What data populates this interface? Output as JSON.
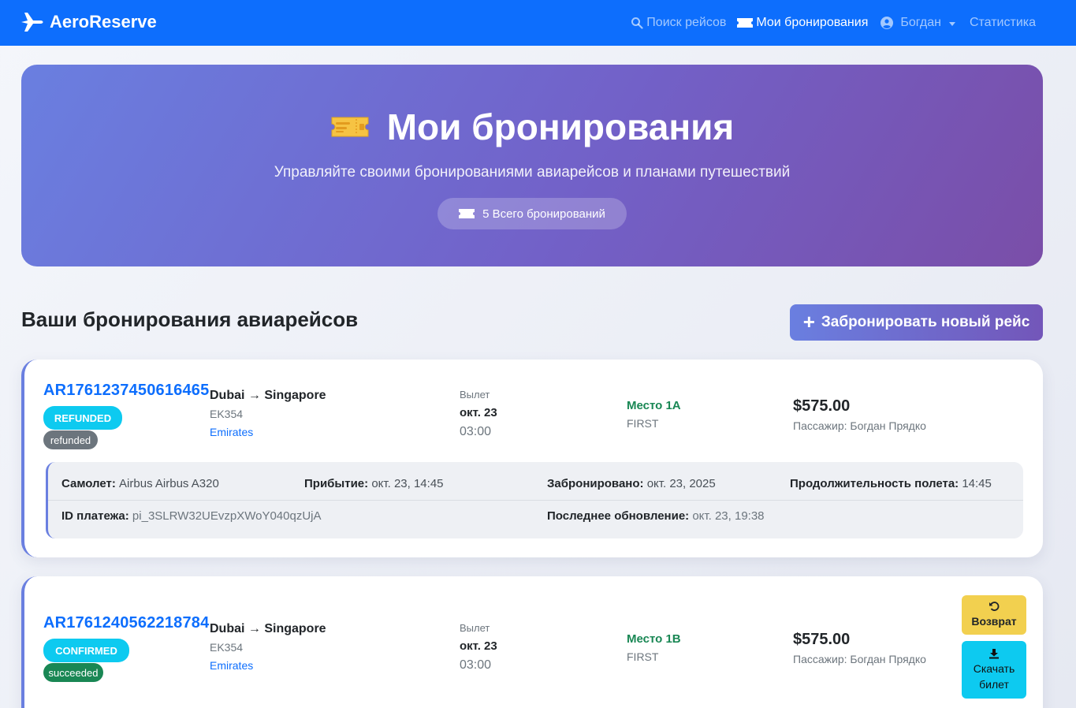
{
  "navbar": {
    "brand": "AeroReserve",
    "items": [
      {
        "label": "Поиск рейсов",
        "icon": "search-icon"
      },
      {
        "label": "Мои бронирования",
        "icon": "ticket-icon"
      },
      {
        "label": "Богдан",
        "icon": "user-circle-icon"
      },
      {
        "label": "Статистика"
      }
    ]
  },
  "hero": {
    "title": "Мои бронирования",
    "subtitle": "Управляйте своими бронированиями авиарейсов и планами путешествий",
    "total_label": "5 Всего бронирований"
  },
  "section": {
    "title": "Ваши бронирования авиарейсов",
    "new_booking_button": "Забронировать новый рейс"
  },
  "bookings": [
    {
      "reference": "AR1761237450616465",
      "status": "REFUNDED",
      "payment_status": "refunded",
      "route": "Dubai → Singapore",
      "flight_number": "EK354",
      "airline": "Emirates",
      "departure_label": "Вылет",
      "departure_date": "окт. 23",
      "departure_time": "03:00",
      "seat": "Место 1A",
      "class": "FIRST",
      "price": "$575.00",
      "passenger": "Пассажир: Богдан Прядко",
      "details": {
        "aircraft_label": "Самолет:",
        "aircraft": "Airbus Airbus A320",
        "arrival_label": "Прибытие:",
        "arrival": "окт. 23, 14:45",
        "booked_label": "Забронировано:",
        "booked": "окт. 23, 2025",
        "duration_label": "Продолжительность полета:",
        "duration": "14:45",
        "payment_id_label": "ID платежа:",
        "payment_id": "pi_3SLRW32UEvzpXWoY040qzUjA",
        "updated_label": "Последнее обновление:",
        "updated": "окт. 23, 19:38"
      }
    },
    {
      "reference": "AR1761240562218784",
      "status": "CONFIRMED",
      "payment_status": "succeeded",
      "route": "Dubai → Singapore",
      "flight_number": "EK354",
      "airline": "Emirates",
      "departure_label": "Вылет",
      "departure_date": "окт. 23",
      "departure_time": "03:00",
      "seat": "Место 1B",
      "class": "FIRST",
      "price": "$575.00",
      "passenger": "Пассажир: Богдан Прядко",
      "actions": {
        "refund": "Возврат",
        "download_line1": "Скачать",
        "download_line2": "билет"
      }
    }
  ]
}
